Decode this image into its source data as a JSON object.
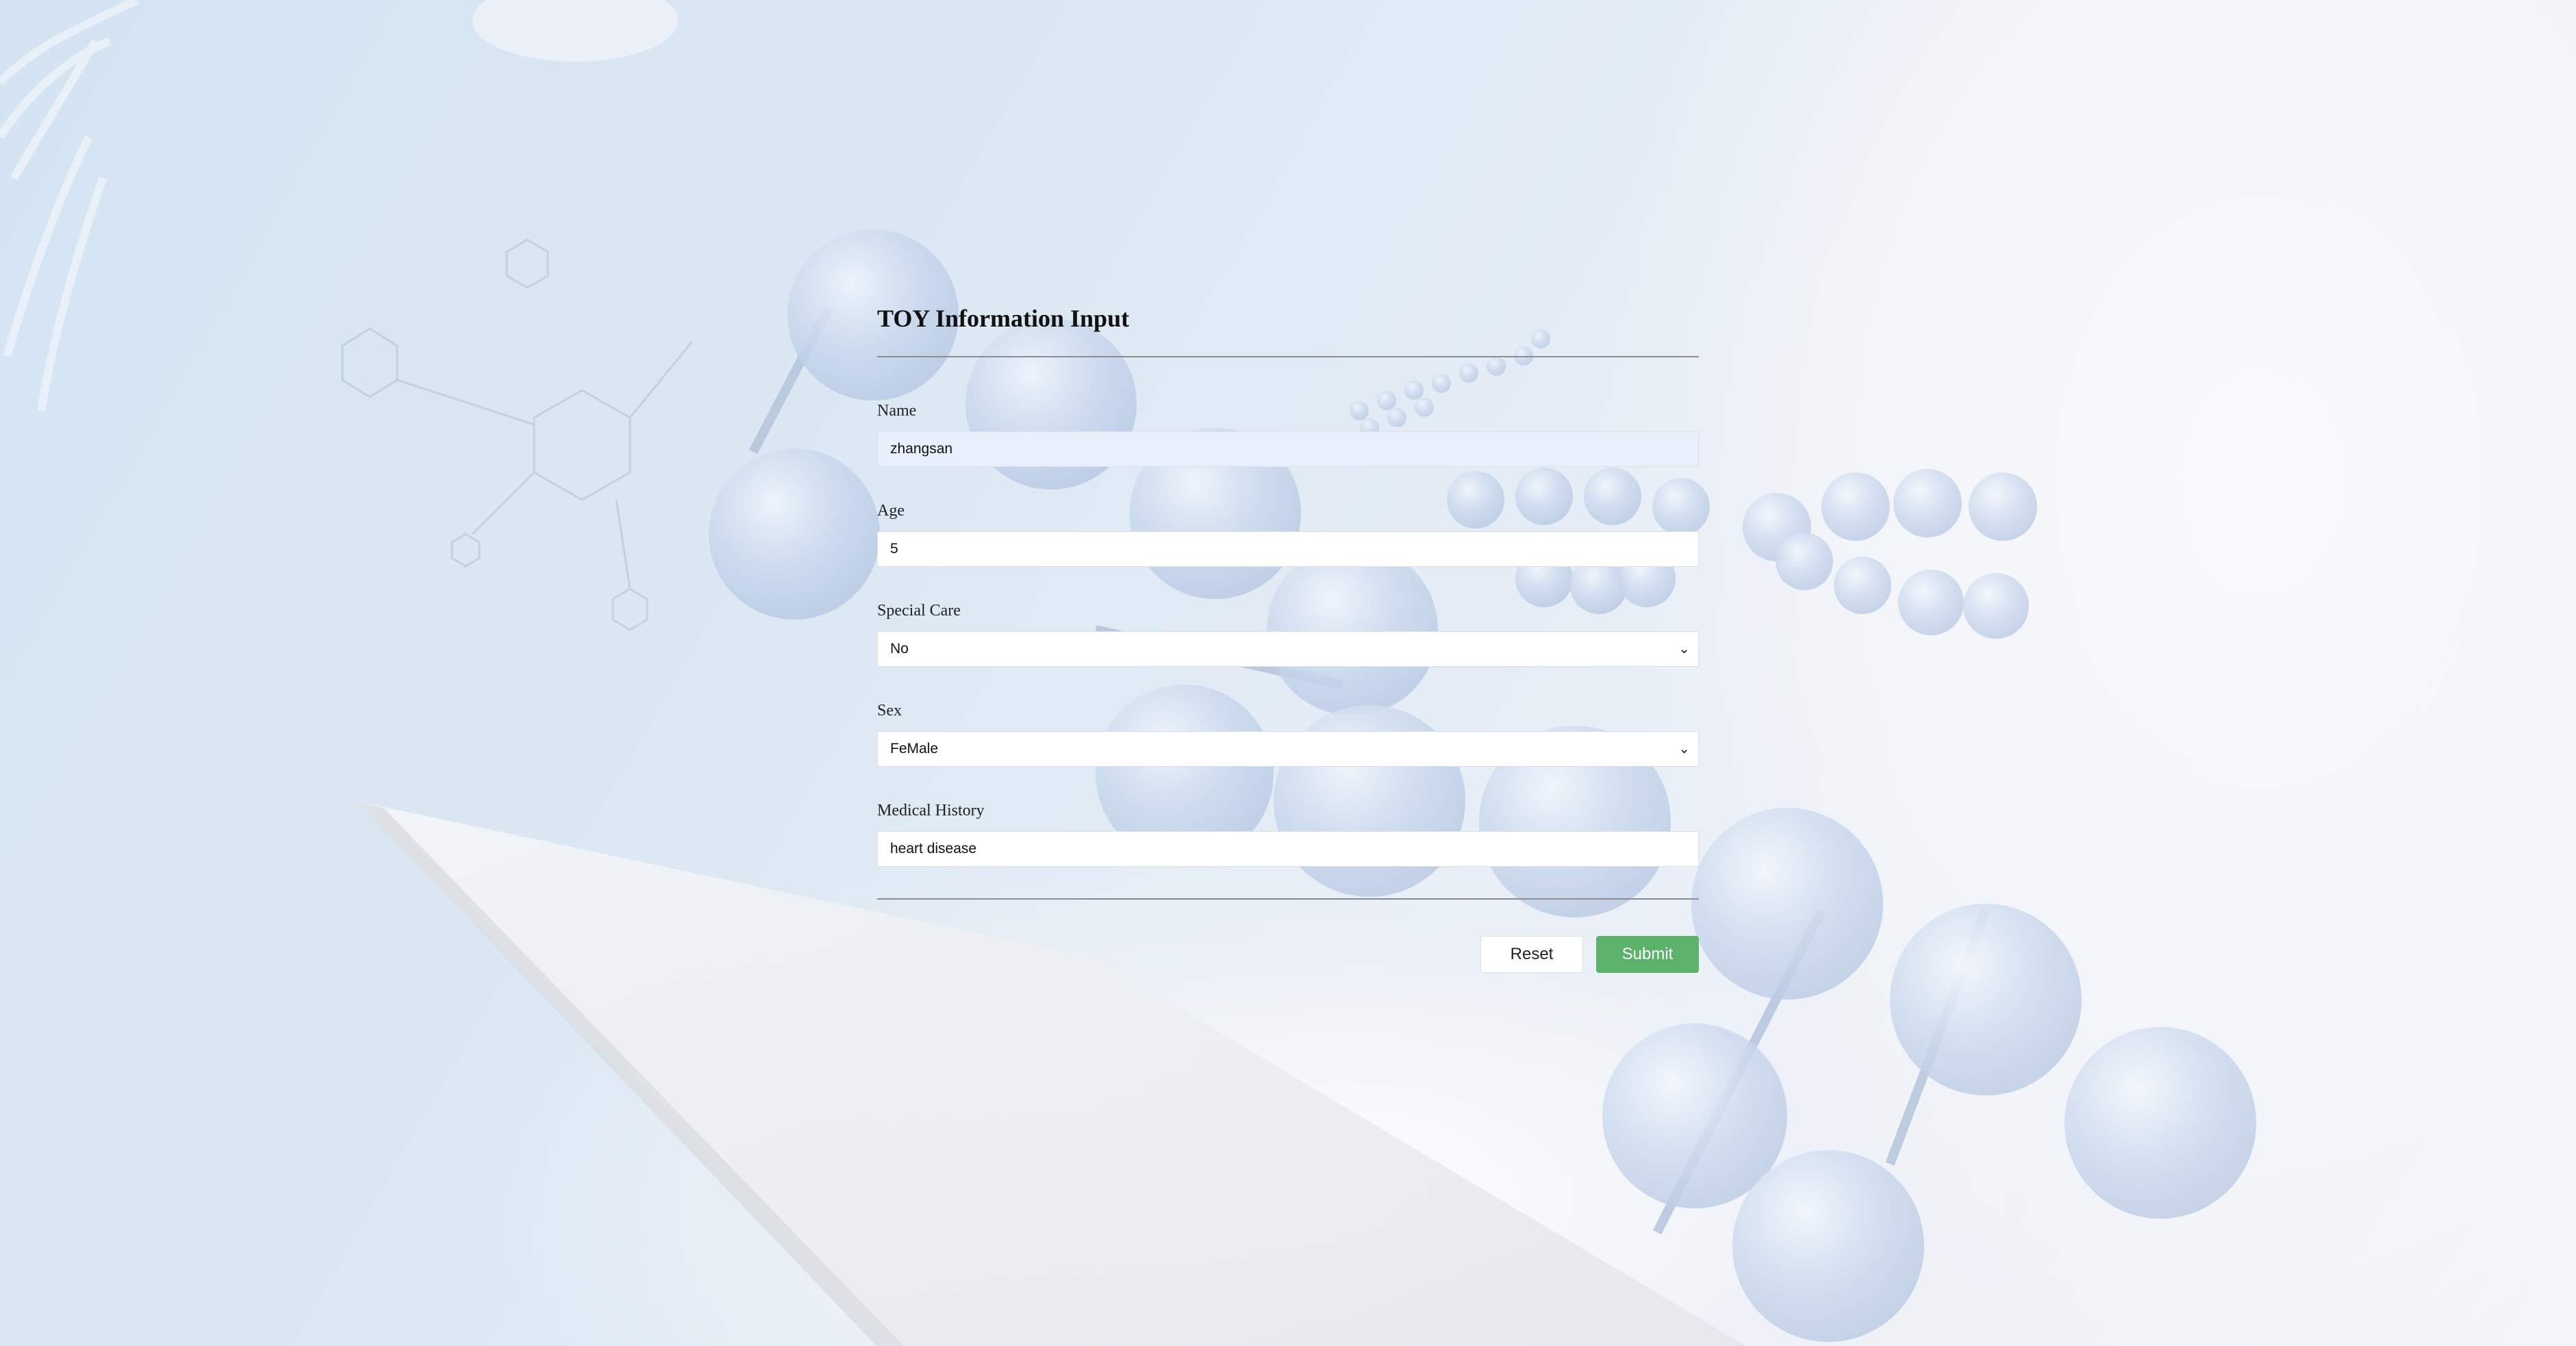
{
  "form": {
    "title": "TOY Information Input",
    "fields": [
      {
        "label": "Name",
        "value": "zhangsan",
        "kind": "text"
      },
      {
        "label": "Age",
        "value": "5",
        "kind": "text"
      },
      {
        "label": "Special Care",
        "value": "No",
        "kind": "select"
      },
      {
        "label": "Sex",
        "value": "FeMale",
        "kind": "select"
      },
      {
        "label": "Medical History",
        "value": "heart disease",
        "kind": "text"
      }
    ],
    "reset_label": "Reset",
    "submit_label": "Submit"
  },
  "colors": {
    "submit_button": "#5bb36b",
    "autofill_field": "#e8f0fe",
    "divider": "#8a8d92"
  },
  "icons": {
    "select_caret": "chevron-down-icon"
  }
}
